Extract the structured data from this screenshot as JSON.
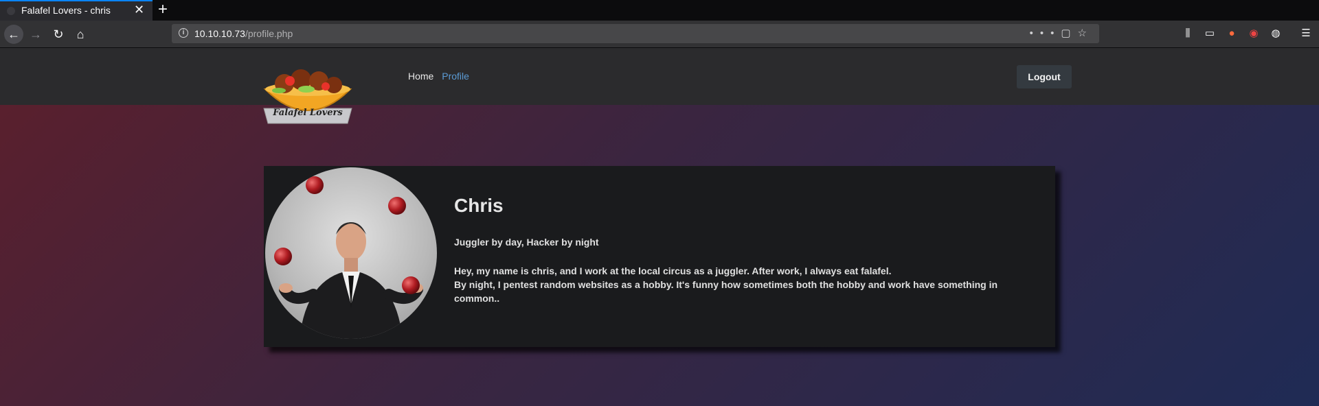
{
  "browser": {
    "tab_title": "Falafel Lovers - chris",
    "url_host": "10.10.10.73",
    "url_path": "/profile.php"
  },
  "site": {
    "logo_text": "Falafel Lovers",
    "nav": [
      {
        "label": "Home"
      },
      {
        "label": "Profile"
      }
    ],
    "logout_label": "Logout"
  },
  "profile": {
    "name": "Chris",
    "tagline": "Juggler by day, Hacker by night",
    "bio_line1": "Hey, my name is chris, and I work at the local circus as a juggler. After work, I always eat falafel.",
    "bio_line2": "By night, I pentest random websites as a hobby. It's funny how sometimes both the hobby and work have something in common.."
  },
  "colors": {
    "accent": "#0a84ff",
    "active_nav": "#5b9bd5"
  }
}
